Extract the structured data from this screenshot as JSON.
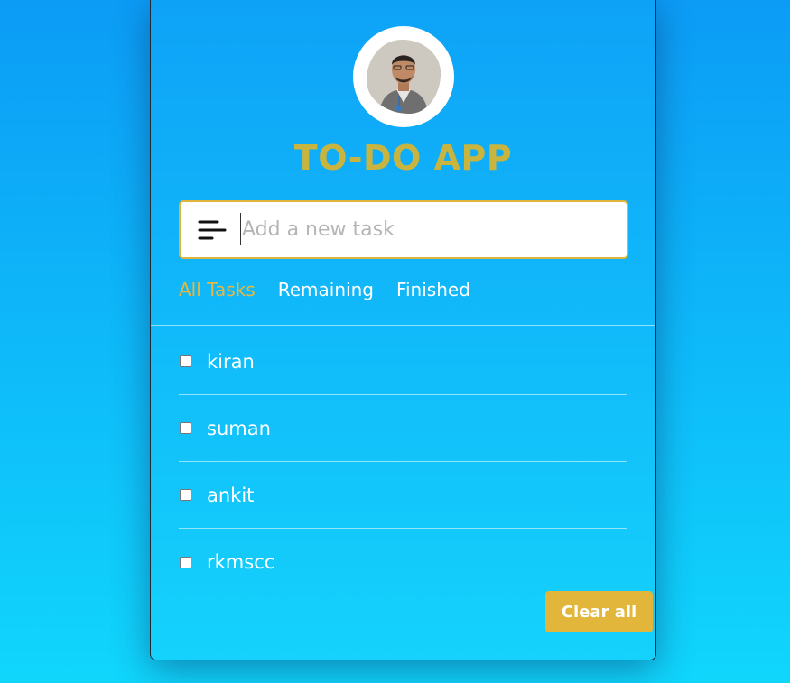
{
  "app": {
    "title": "TO-DO APP",
    "title_color": "#c8b43f",
    "accent_color": "#e1b63a"
  },
  "avatar": {
    "icon": "user-avatar-photo"
  },
  "input": {
    "placeholder": "Add a new task",
    "value": "",
    "icon": "menu-lines-icon"
  },
  "filters": [
    {
      "label": "All Tasks",
      "active": true
    },
    {
      "label": "Remaining",
      "active": false
    },
    {
      "label": "Finished",
      "active": false
    }
  ],
  "tasks": [
    {
      "label": "kiran",
      "checked": false
    },
    {
      "label": "suman",
      "checked": false
    },
    {
      "label": "ankit",
      "checked": false
    },
    {
      "label": "rkmscc",
      "checked": false
    }
  ],
  "actions": {
    "clear_label": "Clear all"
  }
}
